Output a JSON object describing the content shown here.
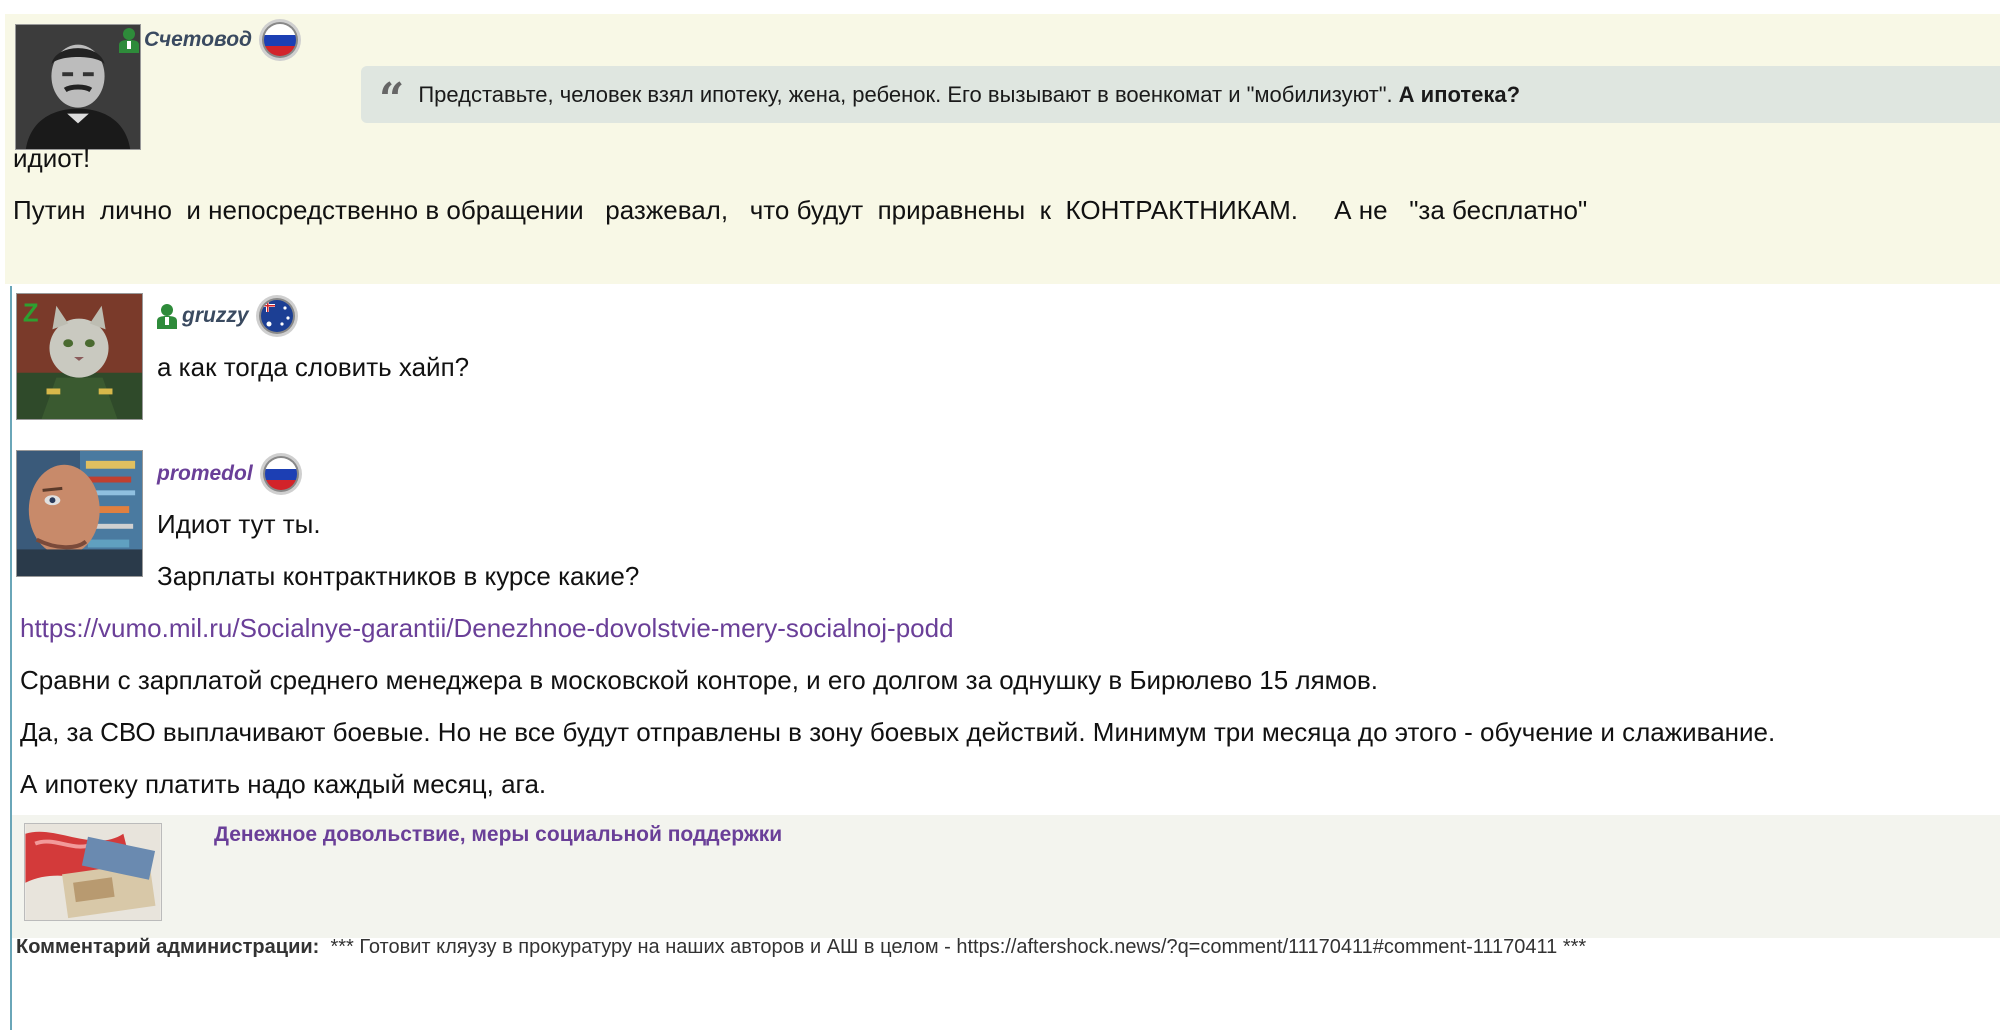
{
  "top_comment": {
    "author": "Счетовод",
    "quote_text": "Представьте, человек взял ипотеку, жена, ребенок. Его вызывают в военкомат и \"мобилизуют\".",
    "quote_bold": "А ипотека?",
    "line1": "идиот!",
    "line2": "Путин  лично  и непосредственно в обращении   разжевал,   что будут  приравнены  к  КОНТРАКТНИКАМ.     А не   \"за бесплатно\""
  },
  "reply1": {
    "author": "gruzzy",
    "text": "а как тогда словить хайп?"
  },
  "reply2": {
    "author": "promedol",
    "line1": "Идиот тут ты.",
    "line2": "Зарплаты контрактников в курсе какие?",
    "link": "https://vumo.mil.ru/Socialnye-garantii/Denezhnoe-dovolstvie-mery-socialnoj-podd",
    "line3": "Сравни с зарплатой среднего менеджера в московской конторе, и его долгом за однушку в Бирюлево 15 лямов.",
    "line4": "Да, за СВО выплачивают боевые. Но не все будут отправлены в зону боевых действий. Минимум три месяца до этого - обучение и слаживание.",
    "line5": "А ипотеку платить надо каждый месяц, ага.",
    "preview_title": "Денежное довольствие, меры социальной поддержки",
    "admin_label": "Комментарий администрации:",
    "admin_text": "*** Готовит кляузу в прокуратуру на наших авторов и АШ в целом - https://aftershock.news/?q=comment/11170411#comment-11170411 ***"
  },
  "colors": {
    "top_bg": "#f8f8e6",
    "quote_bg": "#dfe6e0",
    "link": "#6a3f98",
    "thread_line": "#6aa6b8",
    "user_icon": "#2e8b3a"
  },
  "icons": {
    "user": "user-icon",
    "flag_ru": "russia-flag-icon",
    "flag_au": "australia-flag-icon",
    "quote": "quote-icon"
  }
}
